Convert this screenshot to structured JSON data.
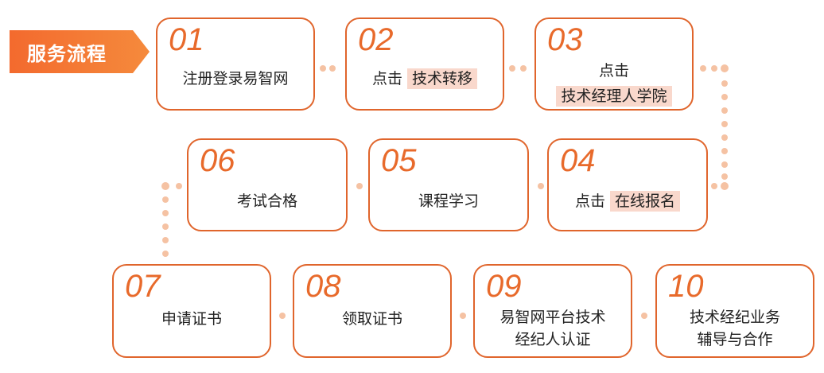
{
  "header": {
    "title": "服务流程"
  },
  "steps": [
    {
      "num": "01",
      "line1": "注册登录易智网"
    },
    {
      "num": "02",
      "prefix": "点击",
      "highlight": "技术转移"
    },
    {
      "num": "03",
      "line1": "点击",
      "highlight": "技术经理人学院"
    },
    {
      "num": "04",
      "prefix": "点击",
      "highlight": "在线报名"
    },
    {
      "num": "05",
      "line1": "课程学习"
    },
    {
      "num": "06",
      "line1": "考试合格"
    },
    {
      "num": "07",
      "line1": "申请证书"
    },
    {
      "num": "08",
      "line1": "领取证书"
    },
    {
      "num": "09",
      "line1": "易智网平台技术",
      "line2": "经纪人认证"
    },
    {
      "num": "10",
      "line1": "技术经纪业务",
      "line2": "辅导与合作"
    }
  ],
  "colors": {
    "accent": "#e0652c",
    "highlight": "#f9d8cc",
    "dots": "#f5c2a3"
  }
}
